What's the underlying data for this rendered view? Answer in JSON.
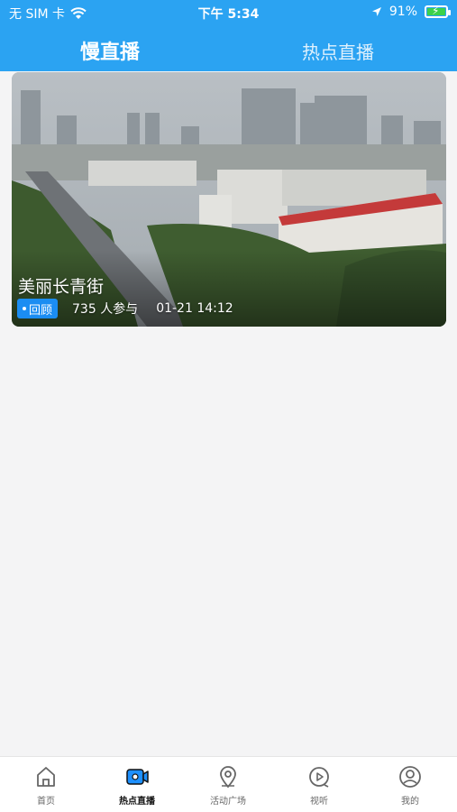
{
  "status_bar": {
    "carrier": "无 SIM 卡",
    "time": "下午 5:34",
    "battery": "91%"
  },
  "tabs": [
    {
      "label": "慢直播",
      "active": true
    },
    {
      "label": "热点直播",
      "active": false
    }
  ],
  "card": {
    "title": "美丽长青街",
    "badge": "回顾",
    "participants": "735 人参与",
    "time": "01-21 14:12"
  },
  "bottom_nav": [
    {
      "label": "首页",
      "icon": "home-icon",
      "active": false
    },
    {
      "label": "热点直播",
      "icon": "live-camera-icon",
      "active": true
    },
    {
      "label": "活动广场",
      "icon": "location-pin-icon",
      "active": false
    },
    {
      "label": "视听",
      "icon": "play-icon",
      "active": false
    },
    {
      "label": "我的",
      "icon": "user-icon",
      "active": false
    }
  ],
  "colors": {
    "header": "#2ba3f2",
    "badge": "#1b8df2",
    "active_icon": "#1e90ff"
  }
}
